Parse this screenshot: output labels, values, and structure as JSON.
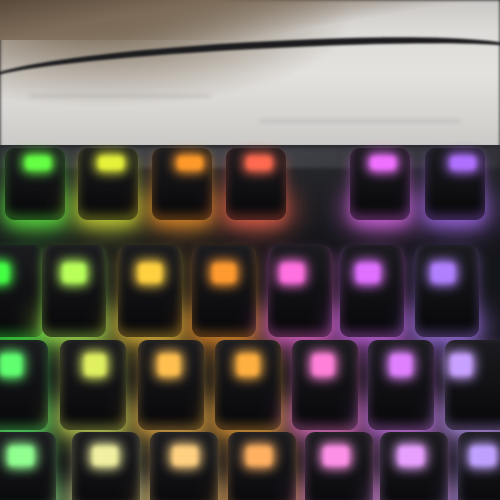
{
  "scene": {
    "description_tags": [
      "fabric-background",
      "keyboard-cable",
      "rgb-mechanical-keyboard"
    ]
  },
  "colors": {
    "fabric": "#e0dedb",
    "keycap": "#111114",
    "rgb": [
      "#7CFF5A",
      "#D8F040",
      "#FFB030",
      "#FF6A5A",
      "#FF5AE0",
      "#C060FF",
      "#A070FF"
    ]
  },
  "keyboard": {
    "rows": [
      {
        "keys": [
          {
            "color": "#66ff44"
          },
          {
            "color": "#e6f23a"
          },
          {
            "color": "#ff9a2a"
          },
          {
            "color": "#ff6a50"
          },
          {
            "color": "#f070ff"
          },
          {
            "color": "#b070ff"
          }
        ]
      },
      {
        "keys": [
          {
            "color": "#44ff44"
          },
          {
            "color": "#b8ff5a"
          },
          {
            "color": "#ffd040"
          },
          {
            "color": "#ff9a30"
          },
          {
            "color": "#ff70e0"
          },
          {
            "color": "#e070ff"
          },
          {
            "color": "#b080ff"
          }
        ]
      },
      {
        "keys": [
          {
            "color": "#60ff70"
          },
          {
            "color": "#e0f060"
          },
          {
            "color": "#ffc050"
          },
          {
            "color": "#ffb040"
          },
          {
            "color": "#ff80d8"
          },
          {
            "color": "#e080ff"
          },
          {
            "color": "#c8a0ff"
          }
        ]
      },
      {
        "keys": [
          {
            "color": "#90ff90"
          },
          {
            "color": "#f0f0a0"
          },
          {
            "color": "#ffd080"
          },
          {
            "color": "#ffb060"
          },
          {
            "color": "#ff90e8"
          },
          {
            "color": "#e8a0ff"
          },
          {
            "color": "#c0a0ff"
          }
        ]
      }
    ]
  }
}
